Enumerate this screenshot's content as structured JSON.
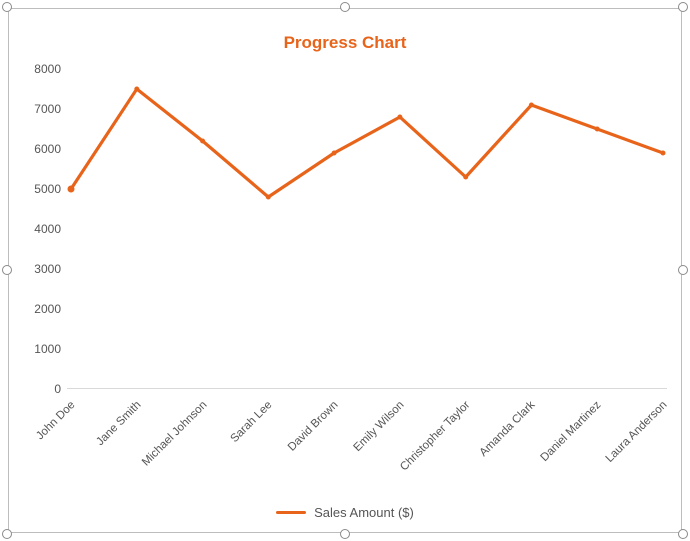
{
  "chart_data": {
    "type": "line",
    "title": "Progress Chart",
    "legend": "Sales Amount ($)",
    "categories": [
      "John Doe",
      "Jane Smith",
      "Michael Johnson",
      "Sarah Lee",
      "David Brown",
      "Emily Wilson",
      "Christopher Taylor",
      "Amanda Clark",
      "Daniel Martinez",
      "Laura Anderson"
    ],
    "series": [
      {
        "name": "Sales Amount ($)",
        "values": [
          5000,
          7500,
          6200,
          4800,
          5900,
          6800,
          5300,
          7100,
          6500,
          5900
        ]
      }
    ],
    "xlabel": "",
    "ylabel": "",
    "ylim": [
      0,
      8000
    ],
    "yticks": [
      0,
      1000,
      2000,
      3000,
      4000,
      5000,
      6000,
      7000,
      8000
    ],
    "line_color": "#e8641b"
  }
}
